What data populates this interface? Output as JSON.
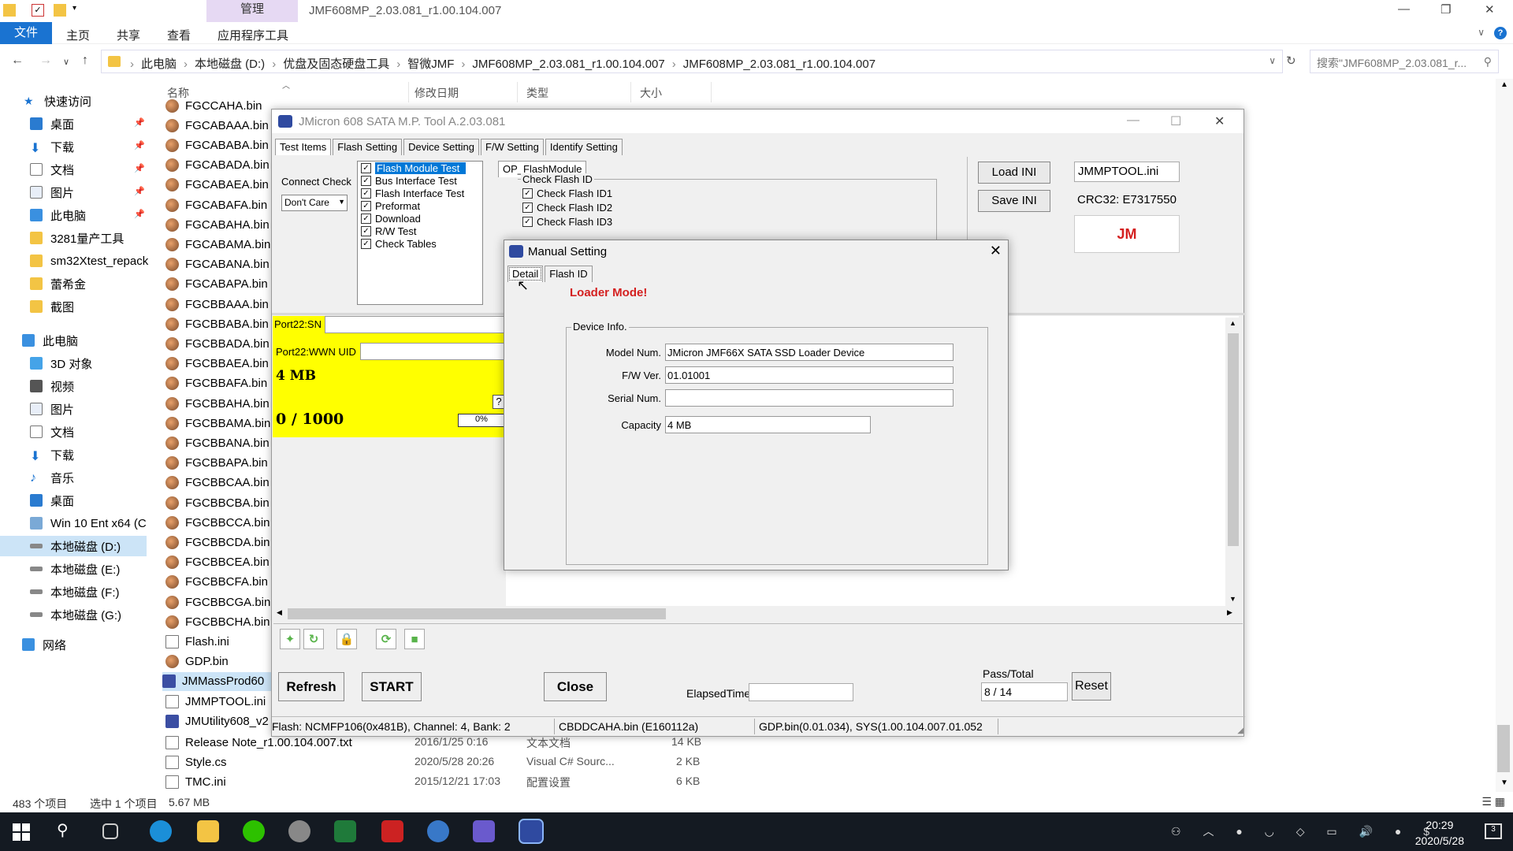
{
  "explorer": {
    "title": "JMF608MP_2.03.081_r1.00.104.007",
    "manage_tab": "管理",
    "ribbon_tabs": [
      "文件",
      "主页",
      "共享",
      "查看",
      "应用程序工具"
    ],
    "breadcrumb": [
      "此电脑",
      "本地磁盘 (D:)",
      "优盘及固态硬盘工具",
      "智微JMF",
      "JMF608MP_2.03.081_r1.00.104.007",
      "JMF608MP_2.03.081_r1.00.104.007"
    ],
    "search_placeholder": "搜索\"JMF608MP_2.03.081_r...",
    "columns": {
      "name": "名称",
      "date": "修改日期",
      "type": "类型",
      "size": "大小"
    },
    "nav": {
      "quick_access": "快速访问",
      "items": [
        "桌面",
        "下载",
        "文档",
        "图片",
        "此电脑",
        "3281量产工具",
        "sm32Xtest_repack",
        "蕾希金",
        "截图"
      ],
      "this_pc": "此电脑",
      "pc_items": [
        "3D 对象",
        "视频",
        "图片",
        "文档",
        "下载",
        "音乐",
        "桌面",
        "Win 10 Ent x64 (C",
        "本地磁盘 (D:)",
        "本地磁盘 (E:)",
        "本地磁盘 (F:)",
        "本地磁盘 (G:)"
      ],
      "network": "网络"
    },
    "files": [
      "FGCCAHA.bin",
      "FGCABAAA.bin",
      "FGCABABA.bin",
      "FGCABADA.bin",
      "FGCABAEA.bin",
      "FGCABAFA.bin",
      "FGCABAHA.bin",
      "FGCABAMA.bin",
      "FGCABANA.bin",
      "FGCABAPA.bin",
      "FGCBBAAA.bin",
      "FGCBBABA.bin",
      "FGCBBADA.bin",
      "FGCBBAEA.bin",
      "FGCBBAFA.bin",
      "FGCBBAHA.bin",
      "FGCBBAMA.bin",
      "FGCBBANA.bin",
      "FGCBBAPA.bin",
      "FGCBBCAA.bin",
      "FGCBBCBA.bin",
      "FGCBBCCA.bin",
      "FGCBBCDA.bin",
      "FGCBBCEA.bin",
      "FGCBBCFA.bin",
      "FGCBBCGA.bin",
      "FGCBBCHA.bin",
      "Flash.ini",
      "GDP.bin",
      "JMMassProd60",
      "JMMPTOOL.ini",
      "JMUtility608_v2"
    ],
    "files_detail": [
      {
        "name": "Release Note_r1.00.104.007.txt",
        "date": "2016/1/25 0:16",
        "type": "文本文档",
        "size": "14 KB"
      },
      {
        "name": "Style.cs",
        "date": "2020/5/28 20:26",
        "type": "Visual C# Sourc...",
        "size": "2 KB"
      },
      {
        "name": "TMC.ini",
        "date": "2015/12/21 17:03",
        "type": "配置设置",
        "size": "6 KB"
      }
    ],
    "status": {
      "count": "483 个项目",
      "selected": "选中 1 个项目",
      "size": "5.67 MB"
    }
  },
  "jm": {
    "title": "JMicron 608 SATA M.P. Tool A.2.03.081",
    "tabs": [
      "Test Items",
      "Flash Setting",
      "Device Setting",
      "F/W Setting",
      "Identify Setting"
    ],
    "connect_check": "Connect Check",
    "connect_value": "Don't Care",
    "tests": [
      "Flash Module Test",
      "Bus Interface Test",
      "Flash Interface Test",
      "Preformat",
      "Download",
      "R/W Test",
      "Check Tables"
    ],
    "op_tab": "OP_FlashModule",
    "check_flash_group": "Check Flash ID",
    "check_flash": [
      "Check Flash ID1",
      "Check Flash ID2",
      "Check Flash ID3"
    ],
    "load_ini": "Load INI",
    "save_ini": "Save INI",
    "ini_file": "JMMPTOOL.ini",
    "crc": "CRC32: E7317550",
    "logo": "JM",
    "port_sn": "Port22:SN",
    "port_wwn": "Port22:WWN UID",
    "capacity": "4 MB",
    "question": "?",
    "progress": "0 / 1000",
    "percent": "0%",
    "refresh": "Refresh",
    "start": "START",
    "close": "Close",
    "elapsed": "ElapsedTime",
    "pass_total_label": "Pass/Total",
    "pass_total": "8 / 14",
    "reset": "Reset",
    "status_flash": "Flash: NCMFP106(0x481B), Channel: 4, Bank: 2",
    "status_bin": "CBDDCAHA.bin (E160112a)",
    "status_gdp": "GDP.bin(0.01.034), SYS(1.00.104.007.01.052"
  },
  "manual": {
    "title": "Manual Setting",
    "tabs": [
      "Detail",
      "Flash ID"
    ],
    "loader": "Loader Mode!",
    "group": "Device Info.",
    "model_label": "Model Num.",
    "model": "JMicron JMF66X SATA SSD Loader Device",
    "fw_label": "F/W Ver.",
    "fw": "01.01001",
    "serial_label": "Serial Num.",
    "serial": "",
    "capacity_label": "Capacity",
    "capacity": "4 MB"
  },
  "taskbar": {
    "time": "20:29",
    "date": "2020/5/28",
    "notif": "3"
  }
}
